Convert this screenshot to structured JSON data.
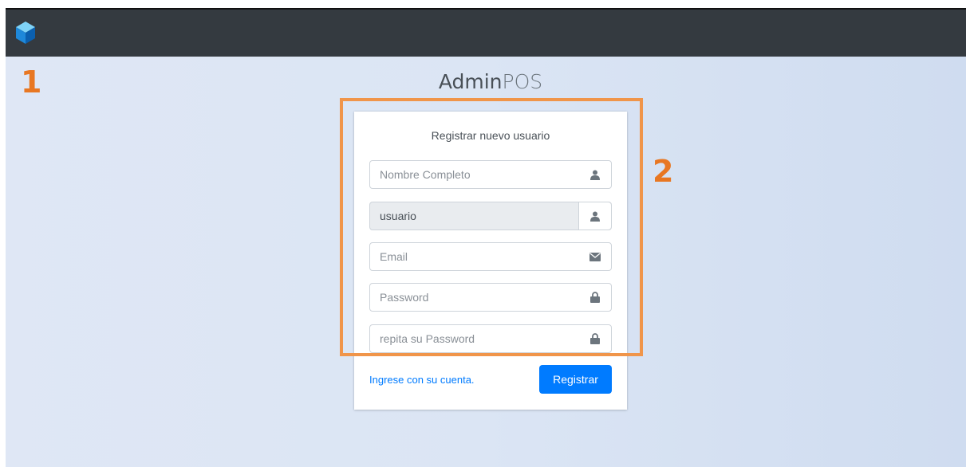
{
  "annotations": {
    "one": "1",
    "two": "2"
  },
  "brand": {
    "bold": "Admin",
    "light": "POS"
  },
  "card": {
    "title": "Registrar nuevo usuario",
    "fields": {
      "nombre": {
        "placeholder": "Nombre Completo",
        "icon": "user-icon"
      },
      "usuario": {
        "value": "usuario",
        "icon": "user-icon"
      },
      "email": {
        "placeholder": "Email",
        "icon": "envelope-icon"
      },
      "password": {
        "placeholder": "Password",
        "icon": "lock-icon"
      },
      "repeat_password": {
        "placeholder": "repita su Password",
        "icon": "lock-icon"
      }
    },
    "login_link": "Ingrese con su cuenta.",
    "register_button": "Registrar"
  },
  "colors": {
    "topbar": "#343a40",
    "primary": "#007bff",
    "annotation": "#e87722"
  }
}
